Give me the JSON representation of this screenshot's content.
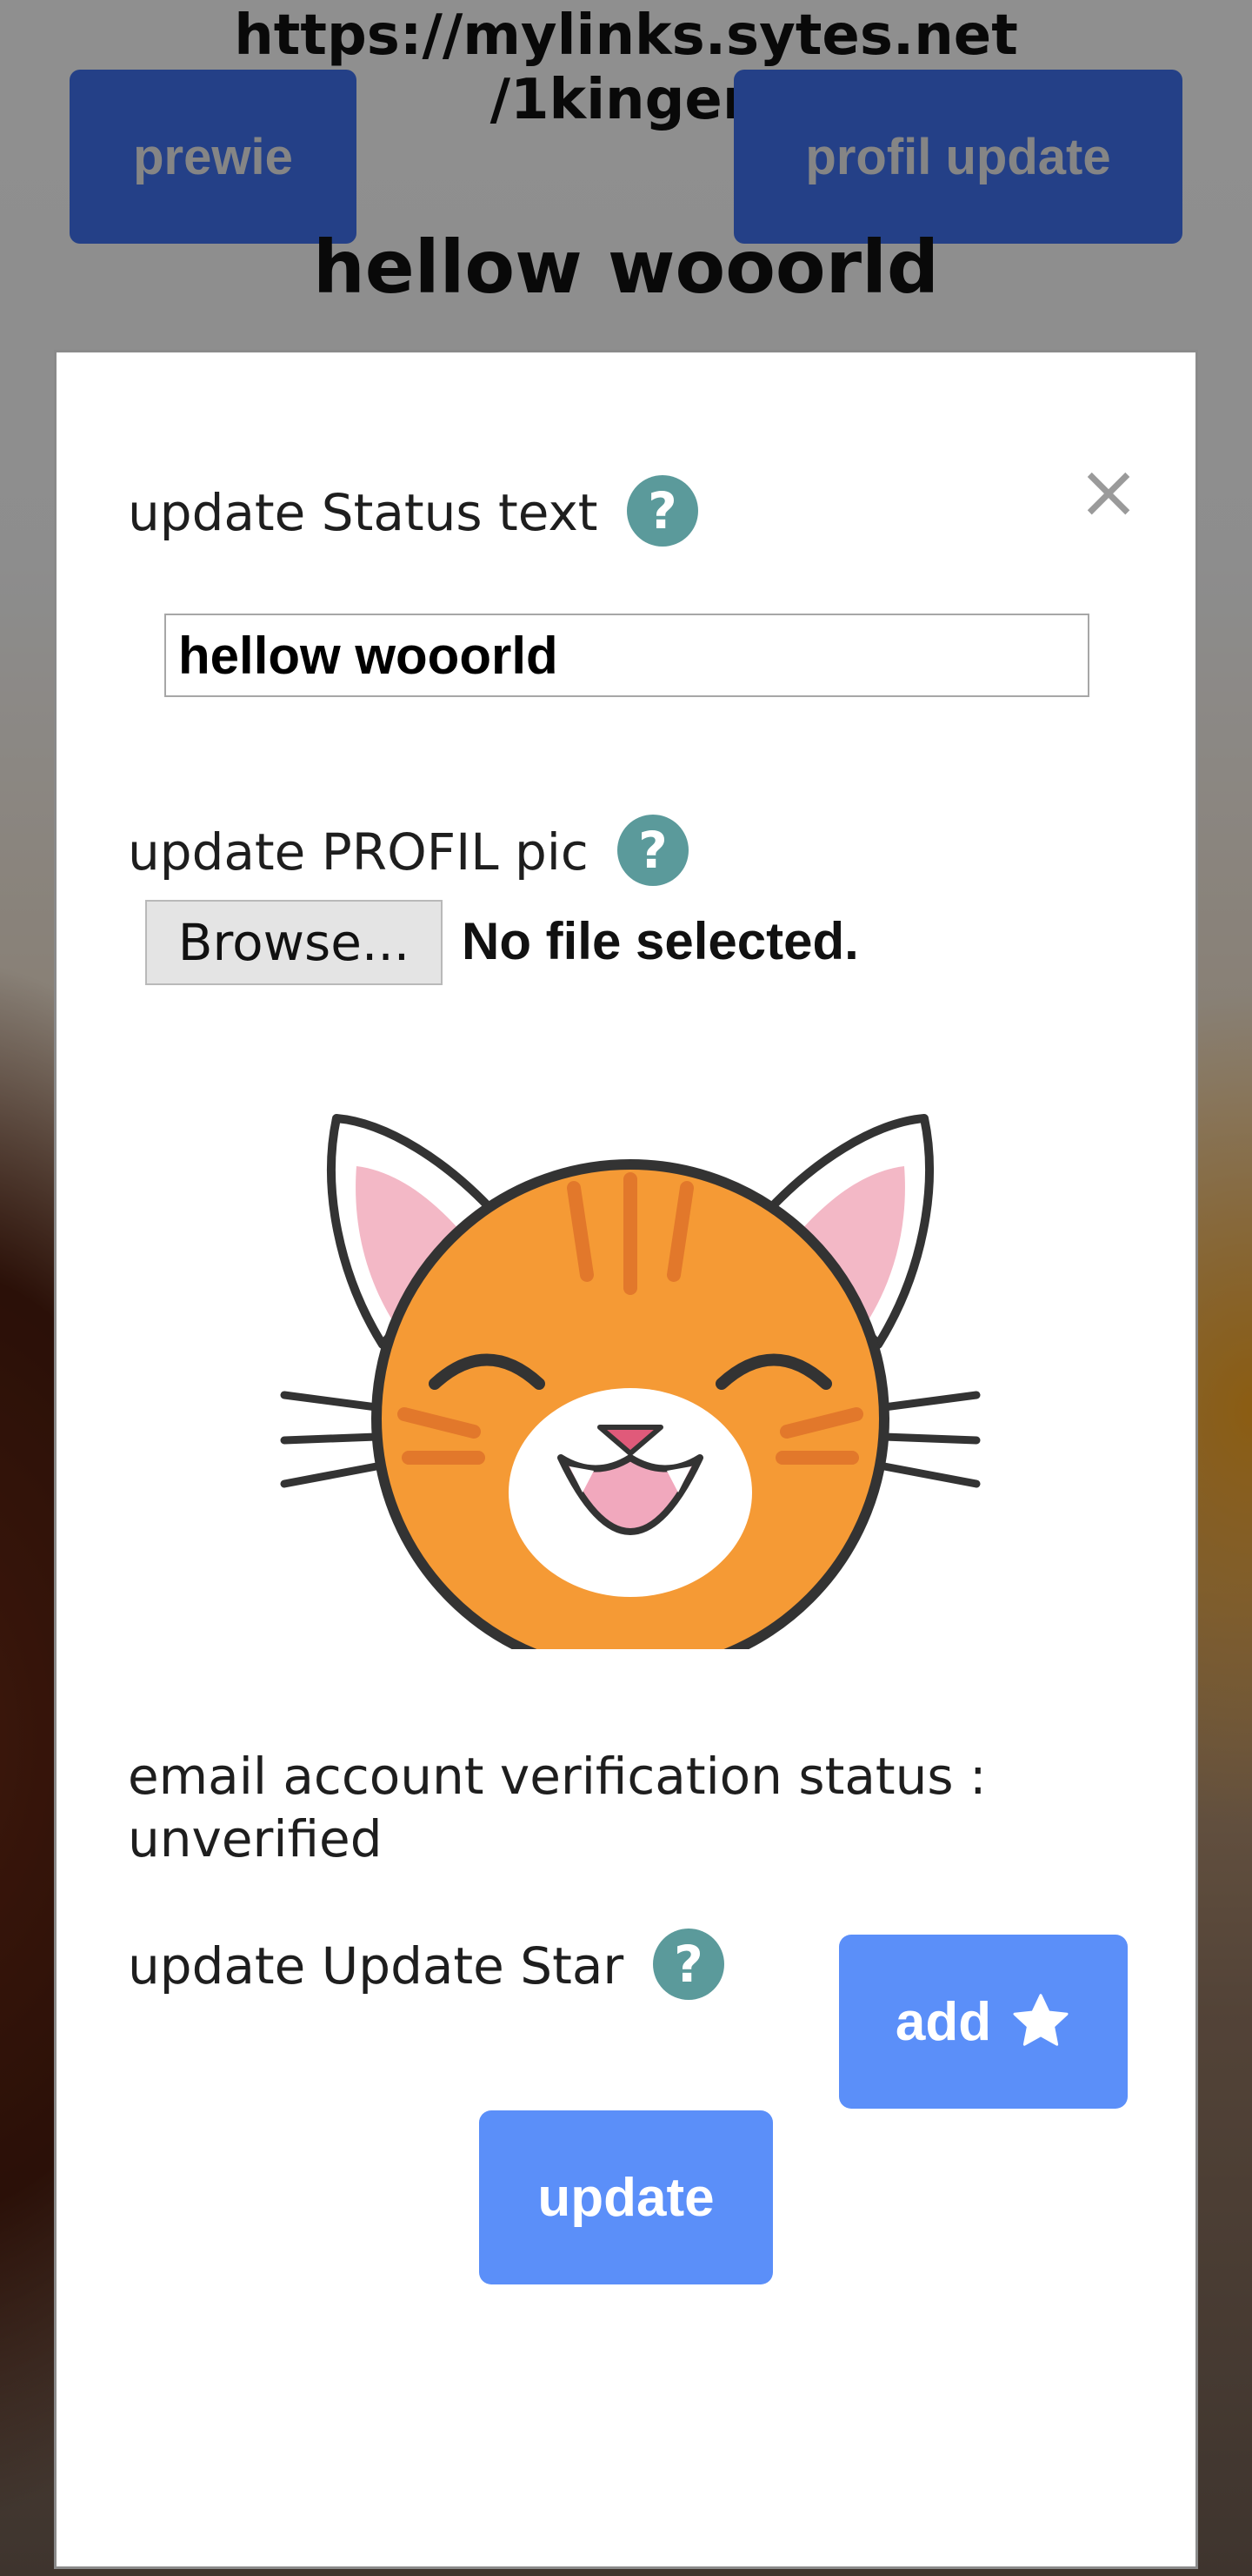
{
  "background": {
    "url_line1": "https://mylinks.sytes.net",
    "url_line2": "/1kingen",
    "prewie_label": "prewie",
    "profil_update_label": "profil update",
    "status_title": "hellow wooorld"
  },
  "modal": {
    "close_glyph": "×",
    "status_label": "update Status text",
    "status_value": "hellow wooorld",
    "profil_pic_label": "update PROFIL pic",
    "browse_label": "Browse...",
    "file_status": "No file selected.",
    "verification_text": "email account verification status : unverified",
    "star_label": "update Update Star",
    "add_label": "add",
    "update_label": "update"
  },
  "colors": {
    "button_blue": "#5b8ff9",
    "help_icon_teal": "#5b9a9b",
    "cat_orange": "#f59a35"
  },
  "icons": [
    "help-icon",
    "close-icon",
    "star-icon",
    "cat-avatar"
  ]
}
